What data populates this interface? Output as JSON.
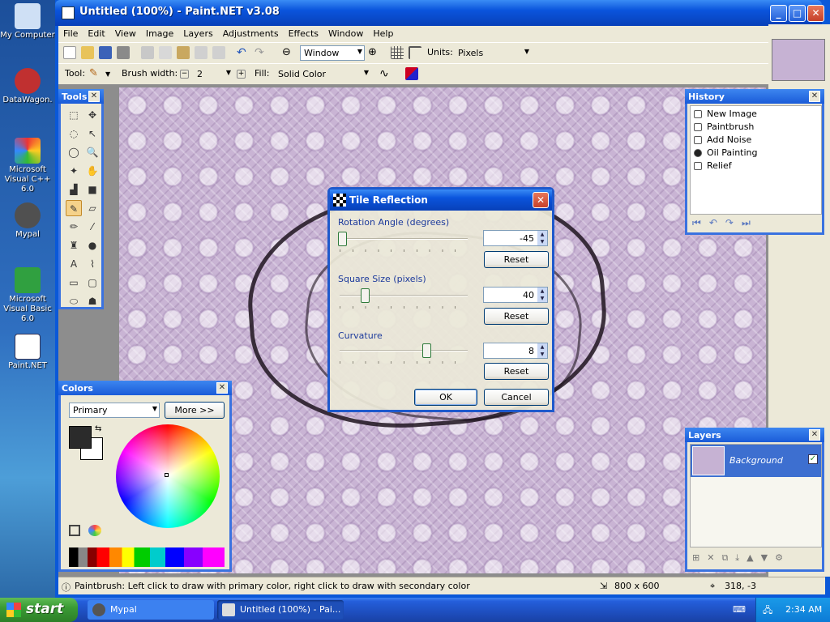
{
  "desktop": {
    "icons": [
      {
        "label": "My Computer",
        "icon": "computer-icon",
        "color": "#cfe0f5"
      },
      {
        "label": "DataWagon.",
        "icon": "datawagon-icon",
        "color": "#c03030"
      },
      {
        "label": "Microsoft Visual C++ 6.0",
        "icon": "visual-cpp-icon",
        "color": "#e0a020"
      },
      {
        "label": "Mypal",
        "icon": "mypal-icon",
        "color": "#404040"
      },
      {
        "label": "Microsoft Visual Basic 6.0",
        "icon": "visual-basic-icon",
        "color": "#30a040"
      },
      {
        "label": "Paint.NET",
        "icon": "paintnet-icon",
        "color": "#ffffff"
      }
    ]
  },
  "window": {
    "title": "Untitled (100%) - Paint.NET v3.08",
    "min": "_",
    "max": "□",
    "close": "✕"
  },
  "menu": [
    "File",
    "Edit",
    "View",
    "Image",
    "Layers",
    "Adjustments",
    "Effects",
    "Window",
    "Help"
  ],
  "toolbar1": {
    "zoom": "Window",
    "units_label": "Units:",
    "units": "Pixels"
  },
  "toolbar2": {
    "tool_label": "Tool:",
    "brush_label": "Brush width:",
    "brush_width": "2",
    "fill_label": "Fill:",
    "fill": "Solid Color"
  },
  "tools": {
    "title": "Tools",
    "items": [
      "rect-select-icon",
      "move-icon",
      "lasso-icon",
      "move-selection-icon",
      "ellipse-select-icon",
      "zoom-icon",
      "magic-wand-icon",
      "pan-icon",
      "paint-bucket-icon",
      "gradient-icon",
      "paintbrush-icon",
      "eraser-icon",
      "pencil-icon",
      "color-picker-icon",
      "clone-stamp-icon",
      "recolor-icon",
      "text-icon",
      "line-icon",
      "rectangle-icon",
      "rounded-rect-icon",
      "ellipse-icon",
      "freeform-icon"
    ]
  },
  "history": {
    "title": "History",
    "items": [
      "New Image",
      "Paintbrush",
      "Add Noise",
      "Oil Painting",
      "Relief"
    ]
  },
  "layers": {
    "title": "Layers",
    "items": [
      {
        "name": "Background",
        "visible": true
      }
    ]
  },
  "colors": {
    "title": "Colors",
    "mode": "Primary",
    "more": "More >>",
    "primary": "#2b2b2b",
    "secondary": "#ffffff"
  },
  "dialog": {
    "title": "Tile Reflection",
    "rotation": {
      "label": "Rotation Angle (degrees)",
      "value": "-45",
      "reset": "Reset"
    },
    "square": {
      "label": "Square Size (pixels)",
      "value": "40",
      "reset": "Reset"
    },
    "curvature": {
      "label": "Curvature",
      "value": "8",
      "reset": "Reset"
    },
    "ok": "OK",
    "cancel": "Cancel"
  },
  "status": {
    "hint": "Paintbrush: Left click to draw with primary color, right click to draw with secondary color",
    "size": "800 x 600",
    "coords": "318, -3"
  },
  "taskbar": {
    "start": "start",
    "tasks": [
      "Mypal",
      "Untitled (100%) - Pai..."
    ],
    "clock": "2:34 AM"
  }
}
